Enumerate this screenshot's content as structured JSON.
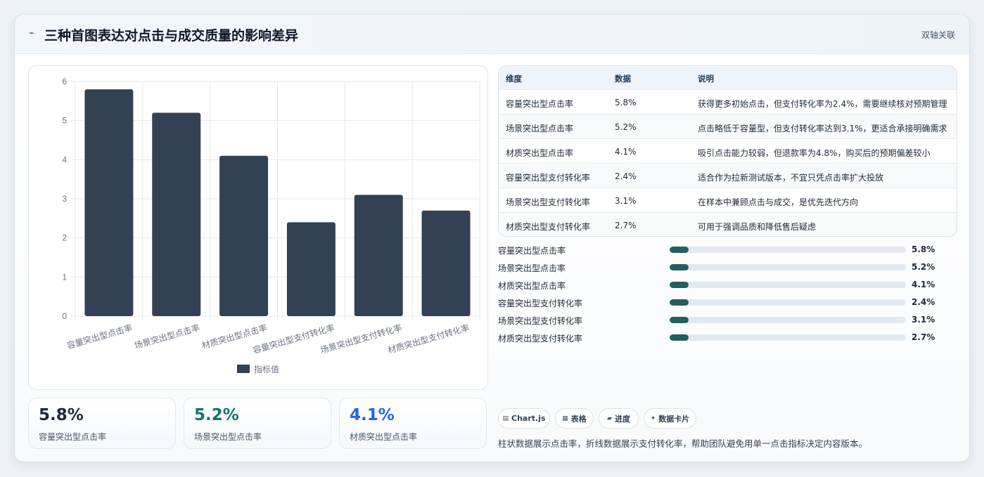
{
  "header": {
    "icon": "bolt-icon",
    "title": "三种首图表达对点击与成交质量的影响差异",
    "tag": "双轴关联"
  },
  "chart_data": {
    "type": "bar",
    "categories": [
      "容量突出型点击率",
      "场景突出型点击率",
      "材质突出型点击率",
      "容量突出型支付转化率",
      "场景突出型支付转化率",
      "材质突出型支付转化率"
    ],
    "series": [
      {
        "name": "指标值",
        "values": [
          5.8,
          5.2,
          4.1,
          2.4,
          3.1,
          2.7
        ]
      }
    ],
    "yticks": [
      "0",
      "1",
      "2",
      "3",
      "4",
      "5",
      "6"
    ],
    "ylim": [
      0,
      6
    ],
    "grid": true,
    "legend": "bottom",
    "bar_color": "#334155"
  },
  "kpis": [
    {
      "value": "5.8%",
      "label": "容量突出型点击率",
      "color": "#1f2937"
    },
    {
      "value": "5.2%",
      "label": "场景突出型点击率",
      "color": "#0f766e"
    },
    {
      "value": "4.1%",
      "label": "材质突出型点击率",
      "color": "#2563eb"
    }
  ],
  "table": {
    "headers": {
      "dim": "维度",
      "data": "数据",
      "desc": "说明"
    },
    "rows": [
      {
        "dim": "容量突出型点击率",
        "data": "5.8%",
        "desc": "获得更多初始点击，但支付转化率为2.4%，需要继续核对预期管理"
      },
      {
        "dim": "场景突出型点击率",
        "data": "5.2%",
        "desc": "点击略低于容量型，但支付转化率达到3.1%，更适合承接明确需求"
      },
      {
        "dim": "材质突出型点击率",
        "data": "4.1%",
        "desc": "吸引点击能力较弱，但退款率为4.8%，购买后的预期偏差较小"
      },
      {
        "dim": "容量突出型支付转化率",
        "data": "2.4%",
        "desc": "适合作为拉新测试版本，不宜只凭点击率扩大投放"
      },
      {
        "dim": "场景突出型支付转化率",
        "data": "3.1%",
        "desc": "在样本中兼顾点击与成交，是优先迭代方向"
      },
      {
        "dim": "材质突出型支付转化率",
        "data": "2.7%",
        "desc": "可用于强调品质和降低售后疑虑"
      }
    ]
  },
  "progress": [
    {
      "label": "容量突出型点击率",
      "value": "5.8%",
      "fraction": 0.08
    },
    {
      "label": "场景突出型点击率",
      "value": "5.2%",
      "fraction": 0.08
    },
    {
      "label": "材质突出型点击率",
      "value": "4.1%",
      "fraction": 0.08
    },
    {
      "label": "容量突出型支付转化率",
      "value": "2.4%",
      "fraction": 0.08
    },
    {
      "label": "场景突出型支付转化率",
      "value": "3.1%",
      "fraction": 0.08
    },
    {
      "label": "材质突出型支付转化率",
      "value": "2.7%",
      "fraction": 0.08
    }
  ],
  "chips": [
    {
      "icon": "chart-icon",
      "label": "Chart.js"
    },
    {
      "icon": "table-icon",
      "label": "表格"
    },
    {
      "icon": "progress-icon",
      "label": "进度"
    },
    {
      "icon": "sparkle-icon",
      "label": "数据卡片"
    }
  ],
  "footnote": "柱状数据展示点击率，折线数据展示支付转化率，帮助团队避免用单一点击指标决定内容版本。"
}
